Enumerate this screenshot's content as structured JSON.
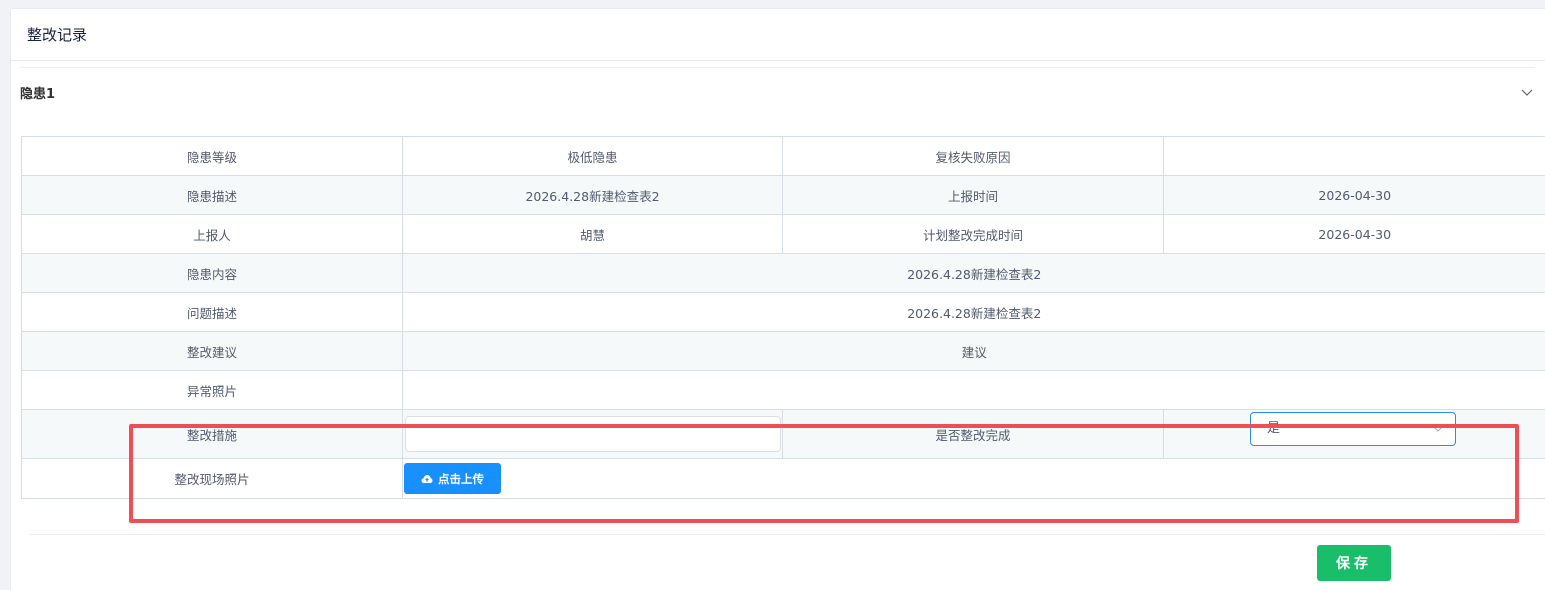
{
  "page": {
    "title": "整改记录"
  },
  "collapse": {
    "title": "隐患1"
  },
  "table": {
    "hazard_level_label": "隐患等级",
    "hazard_level_value": "极低隐患",
    "review_fail_label": "复核失败原因",
    "review_fail_value": "",
    "hazard_desc_label": "隐患描述",
    "hazard_desc_value": "2026.4.28新建检查表2",
    "report_time_label": "上报时间",
    "report_time_value": "2026-04-30",
    "reporter_label": "上报人",
    "reporter_value": "胡慧",
    "plan_time_label": "计划整改完成时间",
    "plan_time_value": "2026-04-30",
    "hazard_content_label": "隐患内容",
    "hazard_content_value": "2026.4.28新建检查表2",
    "problem_desc_label": "问题描述",
    "problem_desc_value": "2026.4.28新建检查表2",
    "suggestion_label": "整改建议",
    "suggestion_value": "建议",
    "abnormal_photo_label": "异常照片",
    "measures_label": "整改措施",
    "measures_value": "",
    "completed_label": "是否整改完成",
    "completed_value": "是",
    "site_photo_label": "整改现场照片",
    "upload_label": "点击上传"
  },
  "actions": {
    "save_label": "保存"
  },
  "colors": {
    "primary": "#1890ff",
    "success": "#19be6b",
    "highlight": "#ee4f56",
    "focus": "#2d8cf0"
  },
  "icons": {
    "collapse": "chevron-down-icon",
    "select": "chevron-down-icon",
    "upload": "cloud-upload-icon"
  }
}
